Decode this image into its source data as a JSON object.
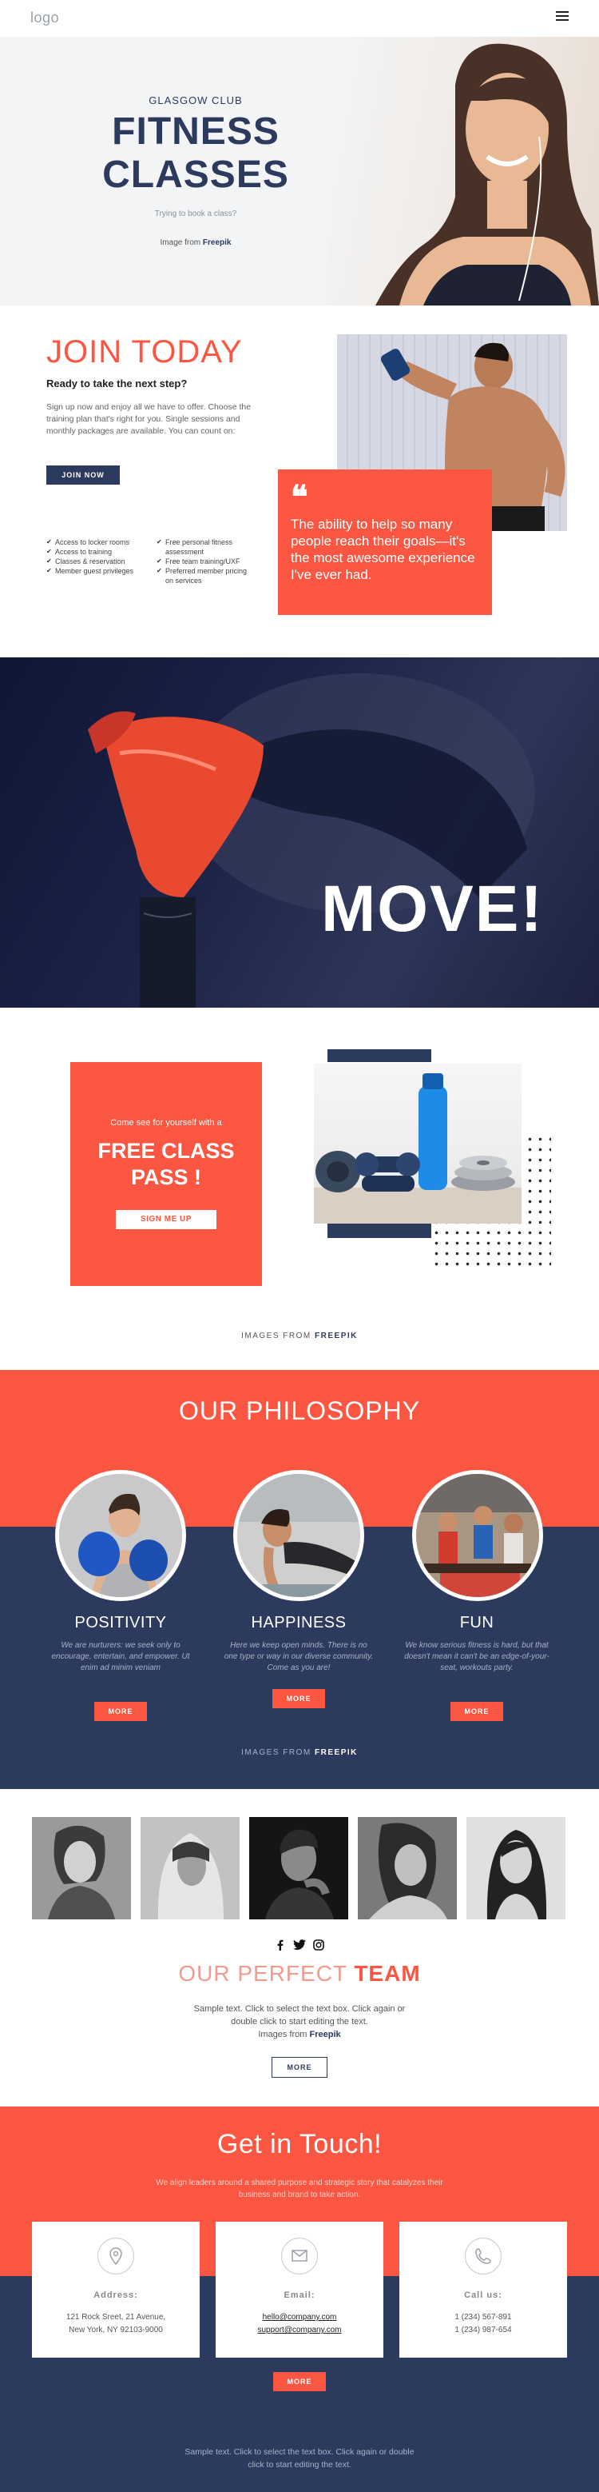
{
  "header": {
    "logo": "logo"
  },
  "hero": {
    "subtitle": "GLASGOW CLUB",
    "title_line1": "FITNESS",
    "title_line2": "CLASSES",
    "question": "Trying to book a class?",
    "credit_prefix": "Image from ",
    "credit_link": "Freepik"
  },
  "join": {
    "title": "JOIN TODAY",
    "subtitle": "Ready to take the next step?",
    "text": "Sign up now and enjoy all we have to offer. Choose the training plan that's right for you. Single sessions and monthly packages are available. You can count on:",
    "button": "JOIN NOW",
    "features_left": [
      "Access to locker rooms",
      "Access to training",
      "Classes & reservation",
      "Member guest privileges"
    ],
    "features_right_1": "Free personal fitness",
    "features_right_1b": "assessment",
    "features_right_2": "Free team training/UXF",
    "features_right_3": "Preferred member pricing",
    "features_right_3b": "on services",
    "quote_mark": "❝",
    "quote": "The ability to help so many people reach their goals—it's the most awesome experience I've ever had."
  },
  "move": {
    "title": "MOVE!"
  },
  "pass": {
    "small": "Come see for yourself with a",
    "big_line1": "FREE CLASS",
    "big_line2": "PASS !",
    "button": "SIGN ME UP",
    "credit_prefix": "IMAGES FROM ",
    "credit_link": "FREEPIK"
  },
  "philosophy": {
    "title": "OUR PHILOSOPHY",
    "items": [
      {
        "name": "POSITIVITY",
        "desc": "We are nurturers: we seek only to encourage, entertain, and empower. Ut enim ad minim veniam",
        "button": "MORE"
      },
      {
        "name": "HAPPINESS",
        "desc": "Here we keep open minds. There is no one type or way in our diverse community. Come as you are!",
        "button": "MORE"
      },
      {
        "name": "FUN",
        "desc": "We know serious fitness is hard, but that doesn't mean it can't be an edge-of-your-seat, workouts party.",
        "button": "MORE"
      }
    ],
    "credit_prefix": "IMAGES FROM ",
    "credit_link": "FREEPIK"
  },
  "team": {
    "title_light": "OUR PERFECT ",
    "title_bold": "TEAM",
    "text": "Sample text. Click to select the text box. Click again or double click to start editing the text.",
    "credit_prefix": "Images from ",
    "credit_link": "Freepik",
    "button": "MORE",
    "social": {
      "facebook": "f",
      "twitter": "t",
      "instagram": "ig"
    }
  },
  "contact": {
    "title": "Get in Touch!",
    "lead": "We align leaders around a shared purpose and strategic story that catalyzes their business and brand to take action.",
    "address_label": "Address:",
    "address_1": "121 Rock Sreet, 21 Avenue,",
    "address_2": "New York, NY 92103-9000",
    "email_label": "Email:",
    "email_1": "hello@company.com",
    "email_2": "support@company.com",
    "phone_label": "Call us:",
    "phone_1": "1 (234) 567-891",
    "phone_2": "1 (234) 987-654",
    "button": "MORE",
    "footer": "Sample text. Click to select the text box. Click again or double click to start editing the text."
  },
  "colors": {
    "accent": "#fa5641",
    "navy": "#2c3a5e"
  }
}
